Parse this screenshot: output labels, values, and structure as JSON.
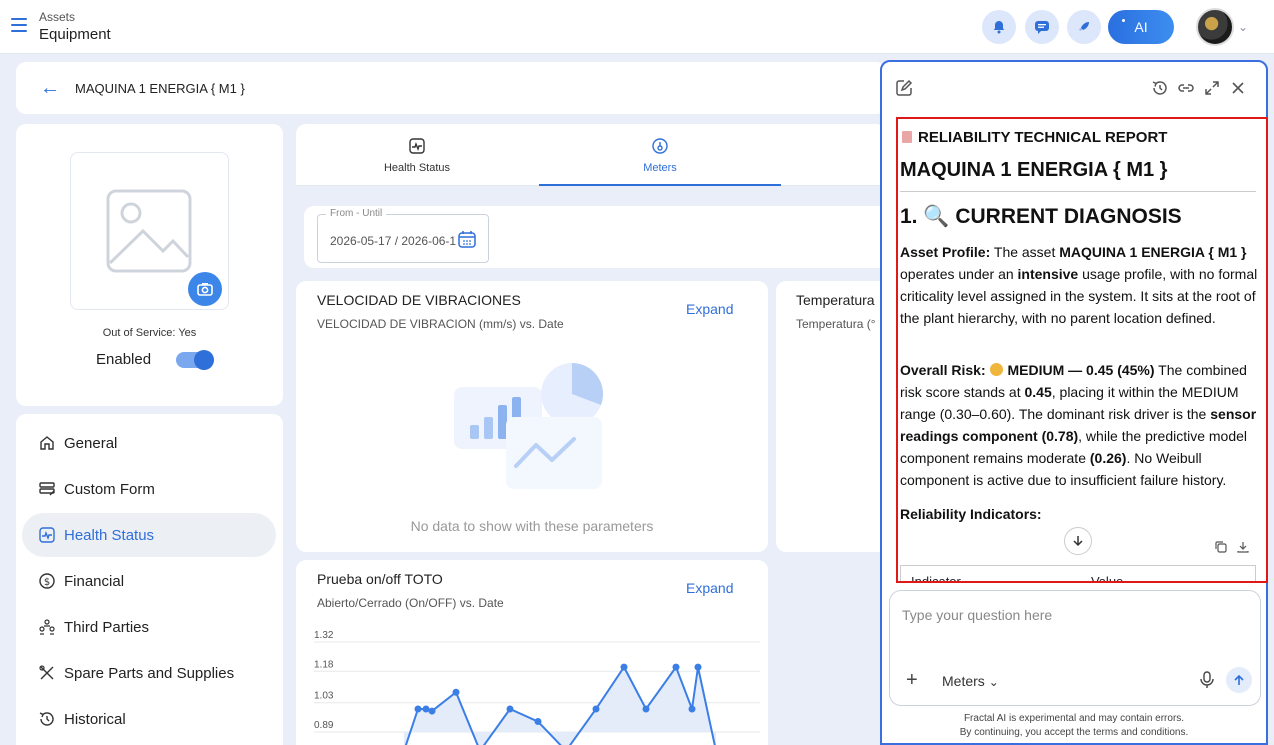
{
  "topbar": {
    "breadcrumb_parent": "Assets",
    "breadcrumb_current": "Equipment",
    "ai_label": "AI"
  },
  "asset": {
    "title": "MAQUINA 1 ENERGIA { M1 }",
    "out_of_service": "Out of Service: Yes",
    "enabled_label": "Enabled"
  },
  "nav": {
    "items": [
      {
        "label": "General",
        "icon": "home-icon"
      },
      {
        "label": "Custom Form",
        "icon": "form-icon"
      },
      {
        "label": "Health Status",
        "icon": "health-icon"
      },
      {
        "label": "Financial",
        "icon": "dollar-icon"
      },
      {
        "label": "Third Parties",
        "icon": "people-icon"
      },
      {
        "label": "Spare Parts and Supplies",
        "icon": "tools-icon"
      },
      {
        "label": "Historical",
        "icon": "history-icon"
      }
    ]
  },
  "tabs": [
    {
      "label": "Health Status"
    },
    {
      "label": "Meters"
    }
  ],
  "date_range": {
    "legend": "From - Until",
    "value": "2026-05-17 / 2026-06-1"
  },
  "charts": {
    "vibration": {
      "title": "VELOCIDAD DE VIBRACIONES",
      "subtitle": "VELOCIDAD DE VIBRACION (mm/s) vs. Date",
      "expand": "Expand",
      "empty": "No data to show with these parameters"
    },
    "temperature": {
      "title": "Temperatura",
      "subtitle": "Temperatura (°"
    },
    "onoff": {
      "title": "Prueba on/off TOTO",
      "subtitle": "Abierto/Cerrado (On/OFF) vs. Date",
      "expand": "Expand"
    }
  },
  "chart_data": {
    "type": "area",
    "y_ticks": [
      "1.32",
      "1.18",
      "1.03",
      "0.89"
    ],
    "ylim": [
      0.89,
      1.32
    ],
    "series": [
      {
        "values": [
          0.8,
          1.0,
          1.0,
          0.99,
          1.08,
          0.8,
          1.0,
          0.94,
          0.8,
          1.0,
          1.2,
          1.0,
          1.2,
          1.0,
          1.2,
          0.8
        ]
      }
    ]
  },
  "report": {
    "kicker": "RELIABILITY TECHNICAL REPORT",
    "title": "MAQUINA 1 ENERGIA { M1 }",
    "section": "1. 🔍 CURRENT DIAGNOSIS",
    "p1_a": "Asset Profile:",
    "p1_b": " The asset ",
    "p1_c": "MAQUINA 1 ENERGIA { M1 }",
    "p1_d": " operates under an ",
    "p1_e": "intensive",
    "p1_f": " usage profile, with no formal criticality level assigned in the system. It sits at the root of the plant hierarchy, with no parent location defined.",
    "p2_a": "Overall Risk: ",
    "p2_b": "MEDIUM — 0.45 (45%)",
    "p2_c": " The combined risk score stands at ",
    "p2_d": "0.45",
    "p2_e": ", placing it within the MEDIUM range (0.30–0.60). The dominant risk driver is the ",
    "p2_f": "sensor readings component (0.78)",
    "p2_g": ", while the predictive model component remains moderate ",
    "p2_h": "(0.26)",
    "p2_i": ". No Weibull component is active due to insufficient failure history.",
    "p3": "Reliability Indicators:",
    "tbl_col1": "Indicator",
    "tbl_col2": "Value"
  },
  "composer": {
    "placeholder": "Type your question here",
    "context": "Meters",
    "disclaimer_1": "Fractal AI is experimental and may contain errors.",
    "disclaimer_2": "By continuing, you accept the terms and conditions."
  }
}
